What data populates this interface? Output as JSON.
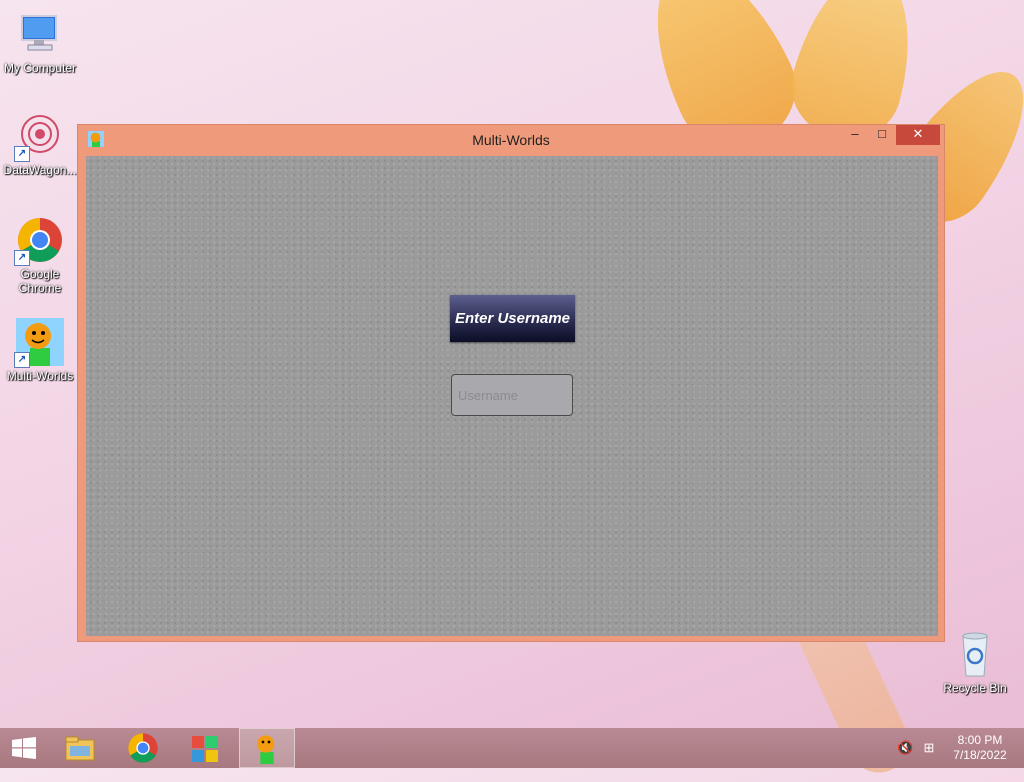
{
  "desktop": {
    "icons": [
      {
        "label": "My Computer"
      },
      {
        "label": "DataWagon..."
      },
      {
        "label": "Google Chrome"
      },
      {
        "label": "Multi-Worlds"
      },
      {
        "label": "Recycle Bin"
      }
    ]
  },
  "window": {
    "title": "Multi-Worlds",
    "heading": "Enter Username",
    "username_placeholder": "Username",
    "username_value": ""
  },
  "taskbar": {
    "time": "8:00 PM",
    "date": "7/18/2022"
  },
  "colors": {
    "window_frame": "#ef9a7a",
    "close_button": "#c7493b",
    "heading_bg": "#2b2d52"
  }
}
